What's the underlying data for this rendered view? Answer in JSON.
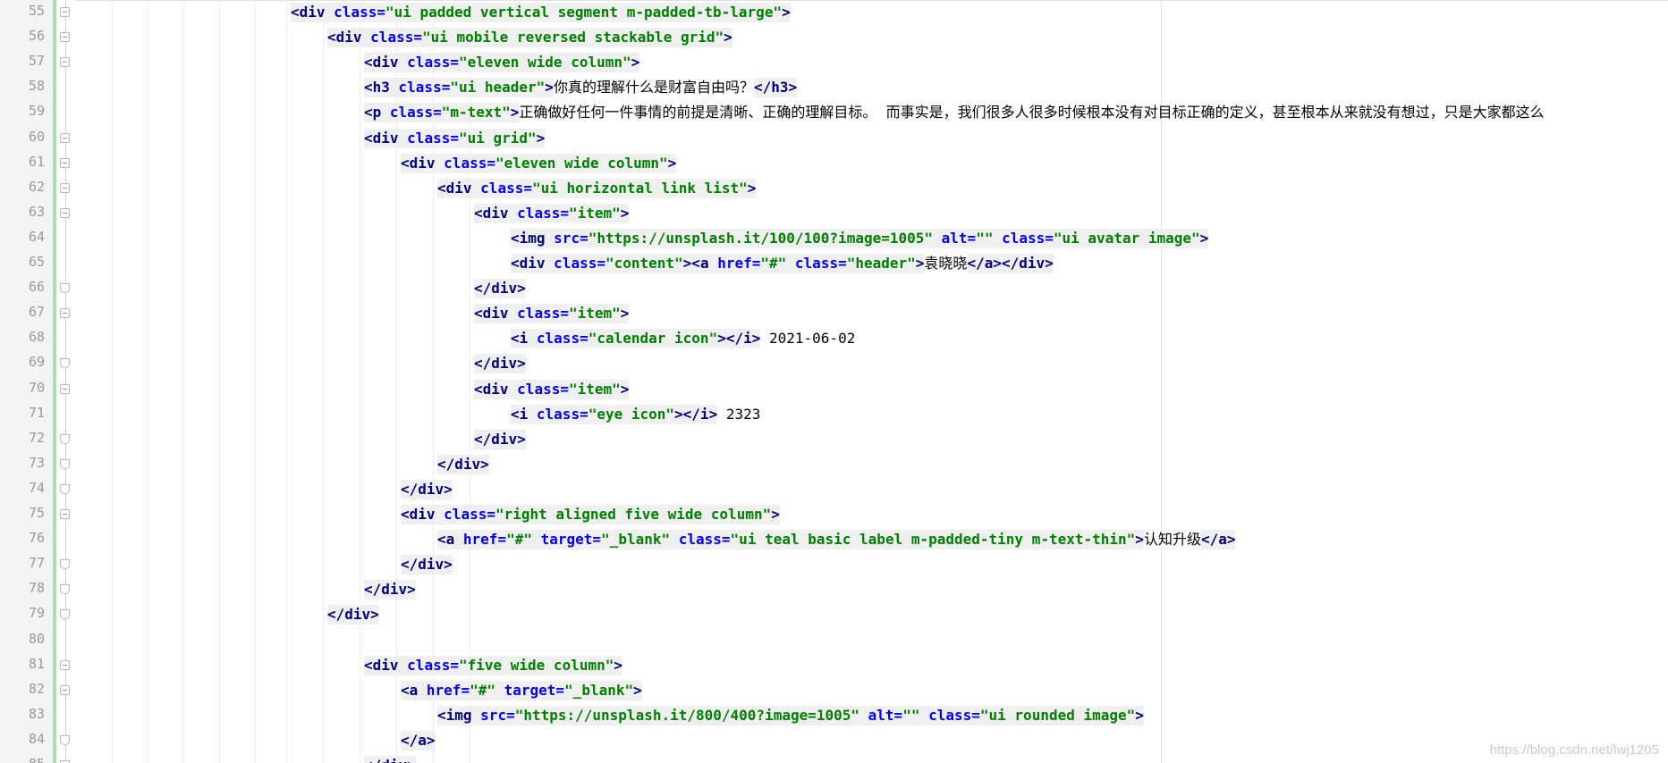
{
  "editor": {
    "lines": [
      {
        "num": "55",
        "indent": 0,
        "fold": "open",
        "code": [
          [
            "tag",
            "<div "
          ],
          [
            "attr",
            "class="
          ],
          [
            "str",
            "\"ui padded vertical segment m-padded-tb-large\""
          ],
          [
            "tag",
            ">"
          ]
        ]
      },
      {
        "num": "56",
        "indent": 1,
        "fold": "open",
        "code": [
          [
            "tag",
            "<div "
          ],
          [
            "attr",
            "class="
          ],
          [
            "str",
            "\"ui mobile reversed stackable grid\""
          ],
          [
            "tag",
            ">"
          ]
        ]
      },
      {
        "num": "57",
        "indent": 2,
        "fold": "open",
        "code": [
          [
            "tag",
            "<div "
          ],
          [
            "attr",
            "class="
          ],
          [
            "str",
            "\"eleven wide column\""
          ],
          [
            "tag",
            ">"
          ]
        ]
      },
      {
        "num": "58",
        "indent": 2,
        "fold": "none",
        "code": [
          [
            "tag",
            "<h3 "
          ],
          [
            "attr",
            "class="
          ],
          [
            "str",
            "\"ui header\""
          ],
          [
            "tag",
            ">"
          ],
          [
            "cjk",
            "你真的理解什么是财富自由吗？"
          ],
          [
            "tag",
            "</h3>"
          ]
        ]
      },
      {
        "num": "59",
        "indent": 2,
        "fold": "none",
        "code": [
          [
            "tag",
            "<p "
          ],
          [
            "attr",
            "class="
          ],
          [
            "str",
            "\"m-text\""
          ],
          [
            "tag",
            ">"
          ],
          [
            "cjk",
            "正确做好任何一件事情的前提是清晰、正确的理解目标。  而事实是，我们很多人很多时候根本没有对目标正确的定义，甚至根本从来就没有想过，只是大家都这么"
          ]
        ]
      },
      {
        "num": "60",
        "indent": 2,
        "fold": "open",
        "code": [
          [
            "tag",
            "<div "
          ],
          [
            "attr",
            "class="
          ],
          [
            "str",
            "\"ui grid\""
          ],
          [
            "tag",
            ">"
          ]
        ]
      },
      {
        "num": "61",
        "indent": 3,
        "fold": "open",
        "code": [
          [
            "tag",
            "<div "
          ],
          [
            "attr",
            "class="
          ],
          [
            "str",
            "\"eleven wide column\""
          ],
          [
            "tag",
            ">"
          ]
        ]
      },
      {
        "num": "62",
        "indent": 4,
        "fold": "open",
        "code": [
          [
            "tag",
            "<div "
          ],
          [
            "attr",
            "class="
          ],
          [
            "str",
            "\"ui horizontal link list\""
          ],
          [
            "tag",
            ">"
          ]
        ]
      },
      {
        "num": "63",
        "indent": 5,
        "fold": "open",
        "code": [
          [
            "tag",
            "<div "
          ],
          [
            "attr",
            "class="
          ],
          [
            "str",
            "\"item\""
          ],
          [
            "tag",
            ">"
          ]
        ]
      },
      {
        "num": "64",
        "indent": 6,
        "fold": "none",
        "code": [
          [
            "tag",
            "<img "
          ],
          [
            "attr",
            "src="
          ],
          [
            "str",
            "\"https://unsplash.it/100/100?image=1005\""
          ],
          [
            "attr",
            " alt="
          ],
          [
            "str",
            "\"\""
          ],
          [
            "attr",
            " class="
          ],
          [
            "str",
            "\"ui avatar image\""
          ],
          [
            "tag",
            ">"
          ]
        ]
      },
      {
        "num": "65",
        "indent": 6,
        "fold": "none",
        "code": [
          [
            "tag",
            "<div "
          ],
          [
            "attr",
            "class="
          ],
          [
            "str",
            "\"content\""
          ],
          [
            "tag",
            "><a "
          ],
          [
            "attr",
            "href="
          ],
          [
            "str",
            "\"#\""
          ],
          [
            "attr",
            " class="
          ],
          [
            "str",
            "\"header\""
          ],
          [
            "tag",
            ">"
          ],
          [
            "cjk",
            "袁晓晓"
          ],
          [
            "tag",
            "</a></div>"
          ]
        ]
      },
      {
        "num": "66",
        "indent": 5,
        "fold": "end",
        "code": [
          [
            "tag",
            "</div>"
          ]
        ]
      },
      {
        "num": "67",
        "indent": 5,
        "fold": "open",
        "code": [
          [
            "tag",
            "<div "
          ],
          [
            "attr",
            "class="
          ],
          [
            "str",
            "\"item\""
          ],
          [
            "tag",
            ">"
          ]
        ]
      },
      {
        "num": "68",
        "indent": 6,
        "fold": "none",
        "code": [
          [
            "tag",
            "<i "
          ],
          [
            "attr",
            "class="
          ],
          [
            "str",
            "\"calendar icon\""
          ],
          [
            "tag",
            "></i>"
          ],
          [
            "txt",
            " 2021-06-02"
          ]
        ]
      },
      {
        "num": "69",
        "indent": 5,
        "fold": "end",
        "code": [
          [
            "tag",
            "</div>"
          ]
        ]
      },
      {
        "num": "70",
        "indent": 5,
        "fold": "open",
        "code": [
          [
            "tag",
            "<div "
          ],
          [
            "attr",
            "class="
          ],
          [
            "str",
            "\"item\""
          ],
          [
            "tag",
            ">"
          ]
        ]
      },
      {
        "num": "71",
        "indent": 6,
        "fold": "none",
        "code": [
          [
            "tag",
            "<i "
          ],
          [
            "attr",
            "class="
          ],
          [
            "str",
            "\"eye icon\""
          ],
          [
            "tag",
            "></i>"
          ],
          [
            "txt",
            " 2323"
          ]
        ]
      },
      {
        "num": "72",
        "indent": 5,
        "fold": "end",
        "code": [
          [
            "tag",
            "</div>"
          ]
        ]
      },
      {
        "num": "73",
        "indent": 4,
        "fold": "end",
        "code": [
          [
            "tag",
            "</div>"
          ]
        ]
      },
      {
        "num": "74",
        "indent": 3,
        "fold": "end",
        "code": [
          [
            "tag",
            "</div>"
          ]
        ]
      },
      {
        "num": "75",
        "indent": 3,
        "fold": "open",
        "code": [
          [
            "tag",
            "<div "
          ],
          [
            "attr",
            "class="
          ],
          [
            "str",
            "\"right aligned five wide column\""
          ],
          [
            "tag",
            ">"
          ]
        ]
      },
      {
        "num": "76",
        "indent": 4,
        "fold": "none",
        "code": [
          [
            "tag",
            "<a "
          ],
          [
            "attr",
            "href="
          ],
          [
            "str",
            "\"#\""
          ],
          [
            "attr",
            " target="
          ],
          [
            "str",
            "\"_blank\""
          ],
          [
            "attr",
            " class="
          ],
          [
            "str",
            "\"ui teal basic label m-padded-tiny m-text-thin\""
          ],
          [
            "tag",
            ">"
          ],
          [
            "cjk",
            "认知升级"
          ],
          [
            "tag",
            "</a>"
          ]
        ]
      },
      {
        "num": "77",
        "indent": 3,
        "fold": "end",
        "code": [
          [
            "tag",
            "</div>"
          ]
        ]
      },
      {
        "num": "78",
        "indent": 2,
        "fold": "end",
        "code": [
          [
            "tag",
            "</div>"
          ]
        ]
      },
      {
        "num": "79",
        "indent": 1,
        "fold": "end",
        "code": [
          [
            "tag",
            "</div>"
          ]
        ]
      },
      {
        "num": "80",
        "indent": 0,
        "fold": "none",
        "code": []
      },
      {
        "num": "81",
        "indent": 2,
        "fold": "open",
        "code": [
          [
            "tag",
            "<div "
          ],
          [
            "attr",
            "class="
          ],
          [
            "str",
            "\"five wide column\""
          ],
          [
            "tag",
            ">"
          ]
        ]
      },
      {
        "num": "82",
        "indent": 3,
        "fold": "open",
        "code": [
          [
            "tag",
            "<a "
          ],
          [
            "attr",
            "href="
          ],
          [
            "str",
            "\"#\""
          ],
          [
            "attr",
            " target="
          ],
          [
            "str",
            "\"_blank\""
          ],
          [
            "tag",
            ">"
          ]
        ]
      },
      {
        "num": "83",
        "indent": 4,
        "fold": "none",
        "code": [
          [
            "tag",
            "<img "
          ],
          [
            "attr",
            "src="
          ],
          [
            "str",
            "\"https://unsplash.it/800/400?image=1005\""
          ],
          [
            "attr",
            " alt="
          ],
          [
            "str",
            "\"\""
          ],
          [
            "attr",
            " class="
          ],
          [
            "str",
            "\"ui rounded image\""
          ],
          [
            "tag",
            ">"
          ]
        ]
      },
      {
        "num": "84",
        "indent": 3,
        "fold": "end",
        "code": [
          [
            "tag",
            "</a>"
          ]
        ]
      },
      {
        "num": "85",
        "indent": 2,
        "fold": "end",
        "code": [
          [
            "tag",
            "</div>"
          ]
        ]
      }
    ]
  },
  "watermark": "https://blog.csdn.net/lwj1205"
}
